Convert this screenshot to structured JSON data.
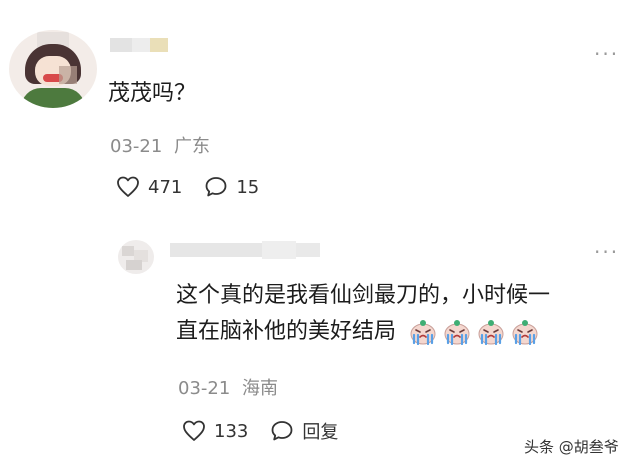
{
  "comment1": {
    "text": "茂茂吗？",
    "date": "03-21",
    "location": "广东",
    "likes": "471",
    "replies": "15",
    "more_glyph": "···"
  },
  "comment2": {
    "text_line1": "这个真的是我看仙剑最刀的，小时候一",
    "text_line2": "直在脑补他的美好结局",
    "date": "03-21",
    "location": "海南",
    "likes": "133",
    "reply_label": "回复",
    "more_glyph": "···",
    "emojis": [
      "crying-face-emoji",
      "crying-face-emoji",
      "crying-face-emoji",
      "crying-face-emoji"
    ]
  },
  "watermark": {
    "text": "头条 @胡叁爷"
  },
  "icons": {
    "like": "heart-outline-icon",
    "comment": "speech-bubble-icon",
    "more": "more-dots-icon"
  },
  "colors": {
    "meta_gray": "#8b8b8b",
    "text_dark": "#1c1c1c"
  }
}
